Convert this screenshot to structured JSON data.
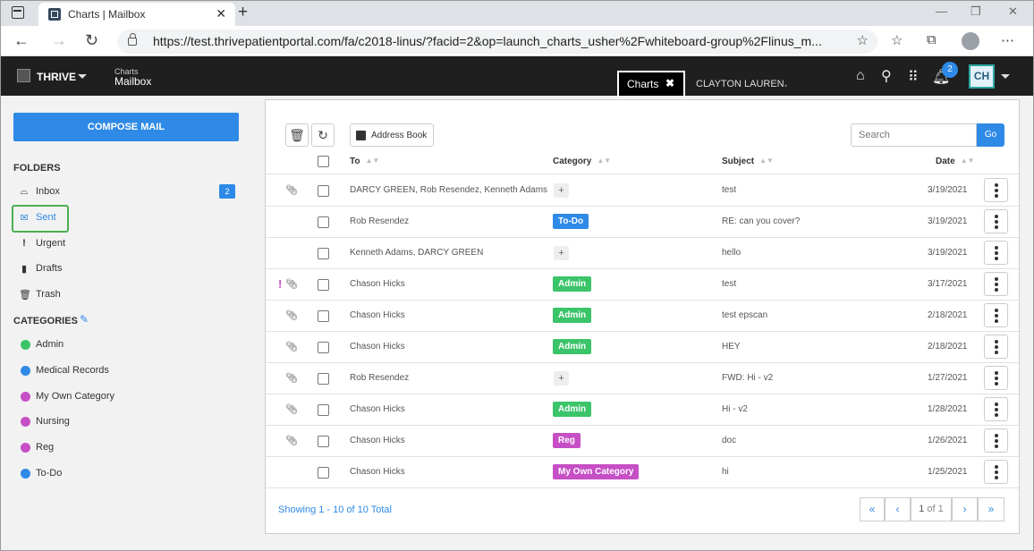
{
  "browser": {
    "tab_title": "Charts | Mailbox",
    "url": "https://test.thrivepatientportal.com/fa/c2018-linus/?facid=2&op=launch_charts_usher%2Fwhiteboard-group%2Flinus_m..."
  },
  "header": {
    "brand": "THRIVE",
    "crumb_small": "Charts",
    "crumb_big": "Mailbox",
    "active_tab": "Charts",
    "patient_name": "CLAYTON LAUREN",
    "notification_count": "2",
    "user_initials": "CH"
  },
  "sidebar": {
    "compose_label": "COMPOSE MAIL",
    "folders_title": "FOLDERS",
    "folders": [
      {
        "label": "Inbox",
        "icon": "inbox-icon",
        "count": "2"
      },
      {
        "label": "Sent",
        "icon": "envelope-icon",
        "active": true
      },
      {
        "label": "Urgent",
        "icon": "exclamation-icon"
      },
      {
        "label": "Drafts",
        "icon": "file-icon"
      },
      {
        "label": "Trash",
        "icon": "trash-icon"
      }
    ],
    "categories_title": "CATEGORIES",
    "categories": [
      {
        "label": "Admin",
        "color": "#3cc46a"
      },
      {
        "label": "Medical Records",
        "color": "#2e8ae6"
      },
      {
        "label": "My Own Category",
        "color": "#c64fc6"
      },
      {
        "label": "Nursing",
        "color": "#c64fc6"
      },
      {
        "label": "Reg",
        "color": "#c64fc6"
      },
      {
        "label": "To-Do",
        "color": "#2e8ae6"
      }
    ]
  },
  "toolbar": {
    "address_book_label": "Address Book",
    "search_placeholder": "Search",
    "go_label": "Go"
  },
  "table": {
    "headers": {
      "to": "To",
      "category": "Category",
      "subject": "Subject",
      "date": "Date"
    },
    "rows": [
      {
        "to": "DARCY GREEN, Rob Resendez, Kenneth Adams",
        "category": "+",
        "subject": "test",
        "date": "3/19/2021",
        "attachment": true,
        "urgent": false
      },
      {
        "to": "Rob Resendez",
        "category": "To-Do",
        "subject": "RE: can you cover?",
        "date": "3/19/2021",
        "attachment": false,
        "urgent": false
      },
      {
        "to": "Kenneth Adams, DARCY GREEN",
        "category": "+",
        "subject": "hello",
        "date": "3/19/2021",
        "attachment": false,
        "urgent": false
      },
      {
        "to": "Chason Hicks",
        "category": "Admin",
        "subject": "test",
        "date": "3/17/2021",
        "attachment": true,
        "urgent": true
      },
      {
        "to": "Chason Hicks",
        "category": "Admin",
        "subject": "test epscan",
        "date": "2/18/2021",
        "attachment": true,
        "urgent": false
      },
      {
        "to": "Chason Hicks",
        "category": "Admin",
        "subject": "HEY",
        "date": "2/18/2021",
        "attachment": true,
        "urgent": false
      },
      {
        "to": "Rob Resendez",
        "category": "+",
        "subject": "FWD: Hi - v2",
        "date": "1/27/2021",
        "attachment": true,
        "urgent": false
      },
      {
        "to": "Chason Hicks",
        "category": "Admin",
        "subject": "Hi - v2",
        "date": "1/28/2021",
        "attachment": true,
        "urgent": false
      },
      {
        "to": "Chason Hicks",
        "category": "Reg",
        "subject": "doc",
        "date": "1/26/2021",
        "attachment": true,
        "urgent": false
      },
      {
        "to": "Chason Hicks",
        "category": "My Own Category",
        "subject": "hi",
        "date": "1/25/2021",
        "attachment": false,
        "urgent": false
      }
    ]
  },
  "footer": {
    "showing": "Showing 1 - 10 of 10 Total",
    "page_current": "1",
    "page_of": "of 1"
  },
  "tag_colors": {
    "Admin": "#3cc46a",
    "To-Do": "#2e8ae6",
    "Reg": "#c64fc6",
    "My Own Category": "#c64fc6"
  }
}
